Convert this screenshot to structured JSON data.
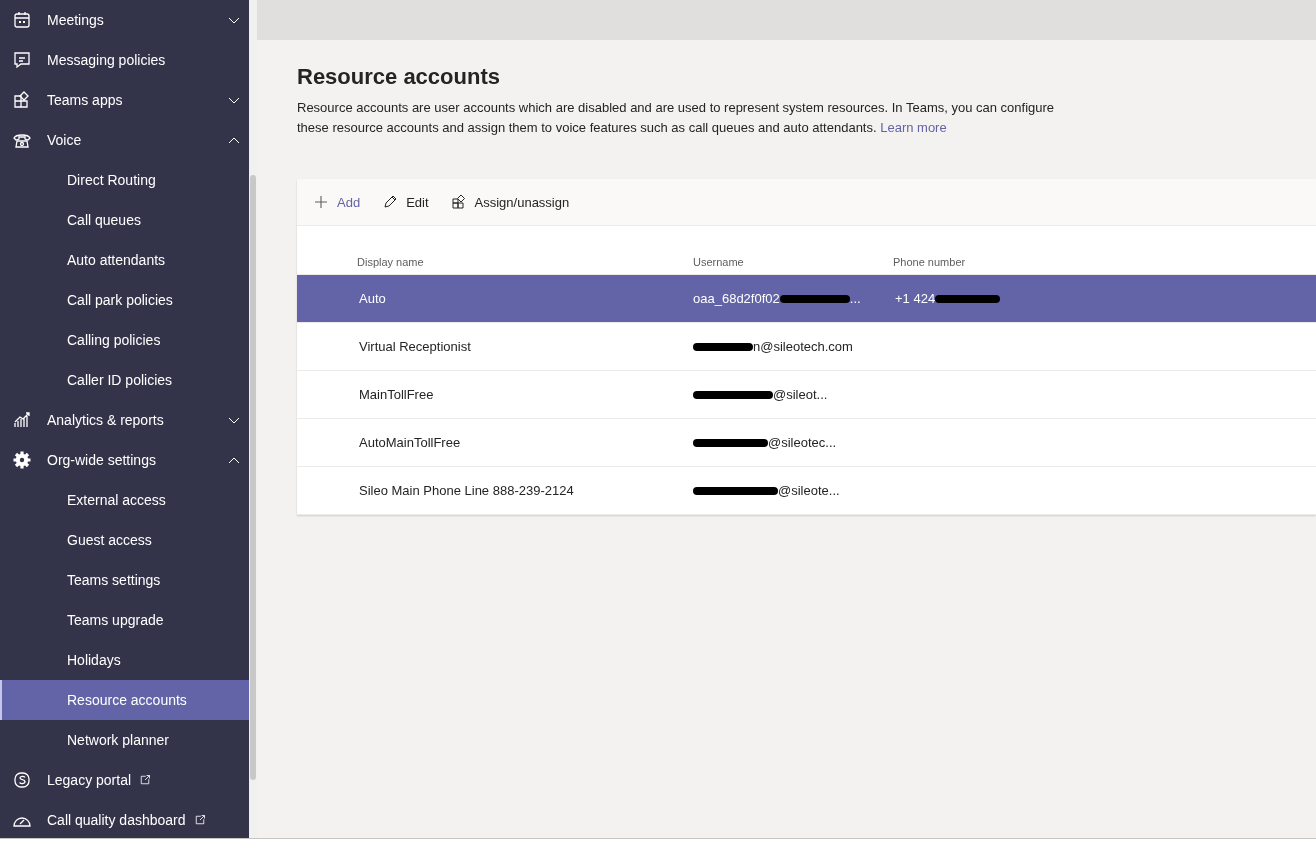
{
  "sidebar": {
    "items": [
      {
        "label": "Meetings",
        "expanded": false
      },
      {
        "label": "Messaging policies"
      },
      {
        "label": "Teams apps",
        "expanded": false
      },
      {
        "label": "Voice",
        "expanded": true,
        "children": [
          {
            "label": "Direct Routing",
            "selected": false
          },
          {
            "label": "Call queues",
            "selected": false
          },
          {
            "label": "Auto attendants",
            "selected": false
          },
          {
            "label": "Call park policies",
            "selected": false
          },
          {
            "label": "Calling policies",
            "selected": false
          },
          {
            "label": "Caller ID policies",
            "selected": false
          }
        ]
      },
      {
        "label": "Analytics & reports",
        "expanded": false
      },
      {
        "label": "Org-wide settings",
        "expanded": true,
        "children": [
          {
            "label": "External access",
            "selected": false
          },
          {
            "label": "Guest access",
            "selected": false
          },
          {
            "label": "Teams settings",
            "selected": false
          },
          {
            "label": "Teams upgrade",
            "selected": false
          },
          {
            "label": "Holidays",
            "selected": false
          },
          {
            "label": "Resource accounts",
            "selected": true
          },
          {
            "label": "Network planner",
            "selected": false
          }
        ]
      },
      {
        "label": "Legacy portal",
        "external": true
      },
      {
        "label": "Call quality dashboard",
        "external": true
      }
    ]
  },
  "page": {
    "title": "Resource accounts",
    "description": "Resource accounts are user accounts which are disabled and are used to represent system resources. In Teams, you can configure these resource accounts and assign them to voice features such as call queues and auto attendants.",
    "link": "Learn more"
  },
  "toolbar": [
    {
      "label": "Add"
    },
    {
      "label": "Edit"
    },
    {
      "label": "Assign/unassign"
    }
  ],
  "table": {
    "columns": [
      "Display name",
      "Username",
      "Phone number"
    ],
    "rows": [
      {
        "selected": true,
        "display_name": "Auto",
        "username": {
          "visible_start": "oaa_68d2f0f02",
          "visible_end": "..."
        },
        "phone": {
          "visible_start": "+1 424"
        }
      },
      {
        "selected": false,
        "display_name": "Virtual Receptionist",
        "username": {
          "visible_end": "n@sileotech.com"
        }
      },
      {
        "selected": false,
        "display_name": "MainTollFree",
        "username": {
          "visible_end": "@sileot..."
        }
      },
      {
        "selected": false,
        "display_name": "AutoMainTollFree",
        "username": {
          "visible_end": "@sileotec..."
        }
      },
      {
        "selected": false,
        "display_name": "Sileo Main Phone Line 888-239-2124",
        "username": {
          "visible_end": "@sileote..."
        }
      }
    ]
  }
}
